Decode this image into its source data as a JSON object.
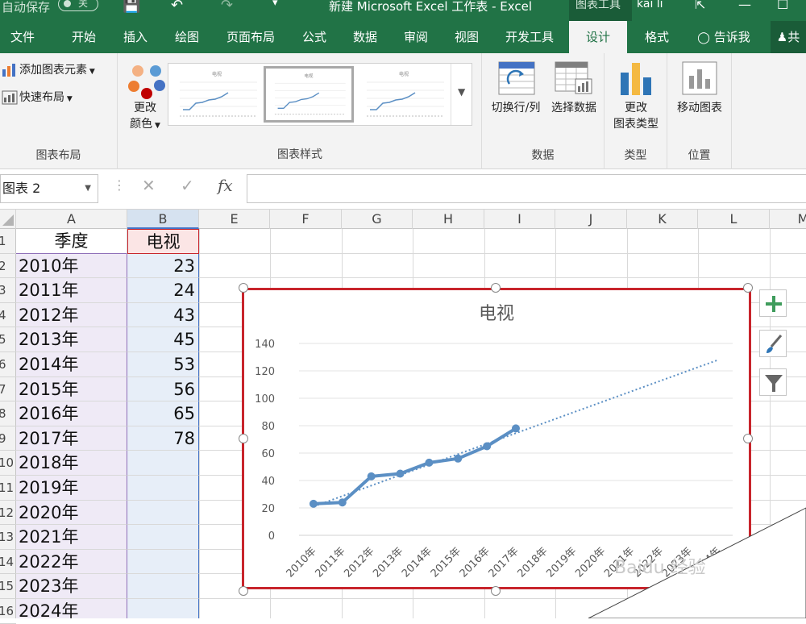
{
  "titlebar": {
    "autosave_label": "自动保存",
    "autosave_state": "关",
    "document_title": "新建 Microsoft Excel 工作表  -  Excel",
    "context_tab": "图表工具",
    "user_name": "kai li"
  },
  "tabs": [
    {
      "label": "文件"
    },
    {
      "label": "开始"
    },
    {
      "label": "插入"
    },
    {
      "label": "绘图"
    },
    {
      "label": "页面布局"
    },
    {
      "label": "公式"
    },
    {
      "label": "数据"
    },
    {
      "label": "审阅"
    },
    {
      "label": "视图"
    },
    {
      "label": "开发工具"
    },
    {
      "label": "设计"
    },
    {
      "label": "格式"
    },
    {
      "label": "告诉我"
    },
    {
      "label": "共"
    }
  ],
  "ribbon": {
    "add_element": "添加图表元素",
    "quick_layout": "快速布局",
    "group_layout": "图表布局",
    "change_colors_1": "更改",
    "change_colors_2": "颜色",
    "group_styles": "图表样式",
    "switch_row_col": "切换行/列",
    "select_data": "选择数据",
    "group_data": "数据",
    "change_type_1": "更改",
    "change_type_2": "图表类型",
    "group_type": "类型",
    "move_chart": "移动图表",
    "group_location": "位置",
    "thumb_title": "电视"
  },
  "formula_bar": {
    "name_box": "图表 2",
    "fx": "fx"
  },
  "sheet": {
    "columns": [
      "A",
      "B",
      "E",
      "F",
      "G",
      "H",
      "I",
      "J",
      "K",
      "L",
      "M"
    ],
    "rows": [
      "1",
      "2",
      "3",
      "4",
      "5",
      "6",
      "7",
      "8",
      "9",
      "10",
      "11",
      "12",
      "13",
      "14",
      "15",
      "16"
    ],
    "header_a": "季度",
    "header_b": "电视",
    "years": [
      "2010年",
      "2011年",
      "2012年",
      "2013年",
      "2014年",
      "2015年",
      "2016年",
      "2017年",
      "2018年",
      "2019年",
      "2020年",
      "2021年",
      "2022年",
      "2023年",
      "2024年"
    ],
    "values": [
      "23",
      "24",
      "43",
      "45",
      "53",
      "56",
      "65",
      "78"
    ]
  },
  "chart_data": {
    "type": "line",
    "title": "电视",
    "categories": [
      "2010年",
      "2011年",
      "2012年",
      "2013年",
      "2014年",
      "2015年",
      "2016年",
      "2017年",
      "2018年",
      "2019年",
      "2020年",
      "2021年",
      "2022年",
      "2023年",
      "2024年"
    ],
    "series": [
      {
        "values": [
          23,
          24,
          43,
          45,
          53,
          56,
          65,
          78
        ],
        "color": "#5b8fc4"
      }
    ],
    "trendline": {
      "type": "linear",
      "style": "dotted",
      "color": "#5b8fc4",
      "from": 21,
      "to": 128
    },
    "ylim": [
      0,
      140
    ],
    "yticks": [
      0,
      20,
      40,
      60,
      80,
      100,
      120,
      140
    ],
    "grid": true,
    "legend": "none"
  },
  "colors": {
    "excel_green": "#217346",
    "selection_red": "#c8252c",
    "series_blue": "#5b8fc4",
    "range_purple": "#8e6fb8",
    "range_blue": "#4472c4"
  },
  "watermark": "Baidu 经验"
}
